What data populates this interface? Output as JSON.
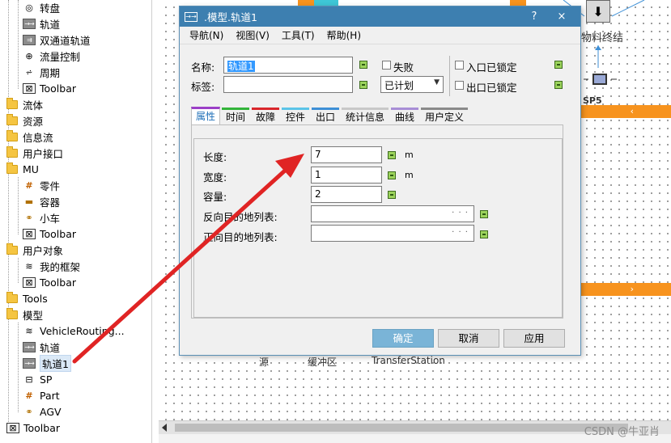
{
  "tree": {
    "items": [
      {
        "label": "转盘",
        "icon": "turntable-icon",
        "level": 2
      },
      {
        "label": "轨道",
        "icon": "track-icon",
        "level": 2
      },
      {
        "label": "双通道轨道",
        "icon": "double-track-icon",
        "level": 2
      },
      {
        "label": "流量控制",
        "icon": "flow-control-icon",
        "level": 2
      },
      {
        "label": "周期",
        "icon": "cycle-icon",
        "level": 2
      },
      {
        "label": "Toolbar",
        "icon": "toolbar-icon",
        "level": 2
      },
      {
        "label": "流体",
        "icon": "folder-icon",
        "level": 1
      },
      {
        "label": "资源",
        "icon": "folder-icon",
        "level": 1
      },
      {
        "label": "信息流",
        "icon": "folder-icon",
        "level": 1
      },
      {
        "label": "用户接口",
        "icon": "folder-icon",
        "level": 1
      },
      {
        "label": "MU",
        "icon": "folder-icon",
        "level": 1
      },
      {
        "label": "零件",
        "icon": "part-icon",
        "level": 2
      },
      {
        "label": "容器",
        "icon": "container-icon",
        "level": 2
      },
      {
        "label": "小车",
        "icon": "cart-icon",
        "level": 2
      },
      {
        "label": "Toolbar",
        "icon": "toolbar-icon",
        "level": 2
      },
      {
        "label": "用户对象",
        "icon": "folder-icon",
        "level": 1
      },
      {
        "label": "我的框架",
        "icon": "frame-icon",
        "level": 2
      },
      {
        "label": "Toolbar",
        "icon": "toolbar-icon",
        "level": 2
      },
      {
        "label": "Tools",
        "icon": "folder-icon",
        "level": 1
      },
      {
        "label": "模型",
        "icon": "folder-icon",
        "level": 1
      },
      {
        "label": "VehicleRouting...",
        "icon": "frame-icon",
        "level": 2
      },
      {
        "label": "轨道",
        "icon": "track-icon",
        "level": 2
      },
      {
        "label": "轨道1",
        "icon": "track-icon",
        "level": 2,
        "selected": true
      },
      {
        "label": "SP",
        "icon": "sp-icon",
        "level": 2
      },
      {
        "label": "Part",
        "icon": "part-icon",
        "level": 2
      },
      {
        "label": "AGV",
        "icon": "cart-icon",
        "level": 2
      },
      {
        "label": "Toolbar",
        "icon": "toolbar-icon",
        "level": 0
      }
    ]
  },
  "canvas": {
    "node_label_1": "物料终结",
    "node_label_2": "SP5",
    "bottom_labels": [
      "源",
      "缓冲区",
      "TransferStation"
    ],
    "orange_bar_chevron_top": "‹",
    "orange_bar_chevron_bottom": "›"
  },
  "dialog": {
    "title": ".模型.轨道1",
    "help_button": "?",
    "close_button": "×",
    "menu": [
      "导航(N)",
      "视图(V)",
      "工具(T)",
      "帮助(H)"
    ],
    "name_label": "名称:",
    "name_value": "轨道1",
    "tag_label": "标签:",
    "tag_value": "",
    "failed_label": "失败",
    "plan_value": "已计划",
    "entry_locked_label": "入口已锁定",
    "exit_locked_label": "出口已锁定",
    "tabs": [
      {
        "label": "属性",
        "color": "#9b3fc7",
        "active": true
      },
      {
        "label": "时间",
        "color": "#33b43a"
      },
      {
        "label": "故障",
        "color": "#d9262b"
      },
      {
        "label": "控件",
        "color": "#5bc4e8"
      },
      {
        "label": "出口",
        "color": "#3d8fd6"
      },
      {
        "label": "统计信息",
        "color": "#c8c8c8"
      },
      {
        "label": "曲线",
        "color": "#a88ed6"
      },
      {
        "label": "用户定义",
        "color": "#8a8a8a"
      }
    ],
    "props": {
      "length_label": "长度:",
      "length_value": "7",
      "length_unit": "m",
      "width_label": "宽度:",
      "width_value": "1",
      "width_unit": "m",
      "capacity_label": "容量:",
      "capacity_value": "2",
      "backward_label": "反向目的地列表:",
      "forward_label": "正向目的地列表:",
      "ellipsis": "· · ·"
    },
    "buttons": {
      "ok": "确定",
      "cancel": "取消",
      "apply": "应用"
    }
  },
  "watermark": "CSDN @牛亚肖",
  "colors": {
    "accent": "#3d7fb0",
    "orange": "#f7931e",
    "arrow": "#e02424"
  }
}
